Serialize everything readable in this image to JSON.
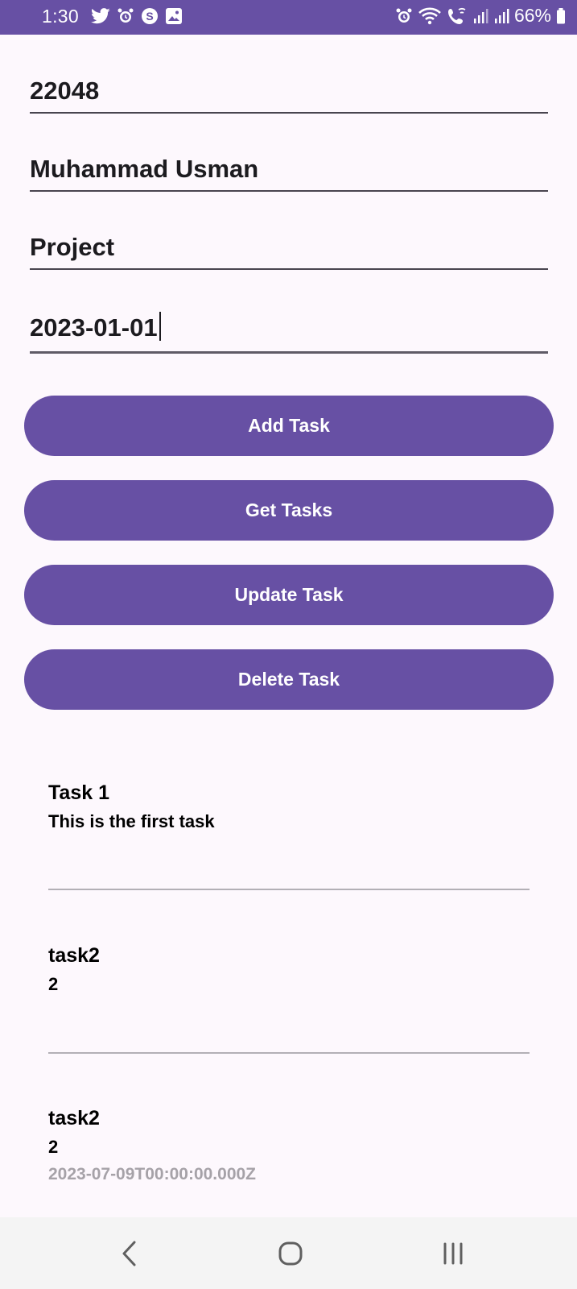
{
  "status_bar": {
    "time": "1:30",
    "battery": "66%",
    "left_icons": [
      "twitter-icon",
      "alarm-icon",
      "skype-icon",
      "gallery-icon"
    ],
    "right_icons": [
      "alarm-icon",
      "wifi-icon",
      "wifi-calling-icon",
      "signal-icon",
      "signal-icon",
      "battery-icon"
    ],
    "color": "#6750a4"
  },
  "form": {
    "id_value": "22048",
    "name_value": "Muhammad Usman",
    "title_value": "Project",
    "date_value": "2023-01-01"
  },
  "buttons": {
    "add": "Add Task",
    "get": "Get Tasks",
    "update": "Update Task",
    "delete": "Delete Task",
    "color": "#6750a4"
  },
  "tasks": [
    {
      "title": "Task 1",
      "description": "This is the first task",
      "date": ""
    },
    {
      "title": "task2",
      "description": "2",
      "date": ""
    },
    {
      "title": "task2",
      "description": "2",
      "date": "2023-07-09T00:00:00.000Z"
    }
  ],
  "nav_bar": {
    "back": "back-icon",
    "home": "home-icon",
    "recents": "recents-icon"
  }
}
